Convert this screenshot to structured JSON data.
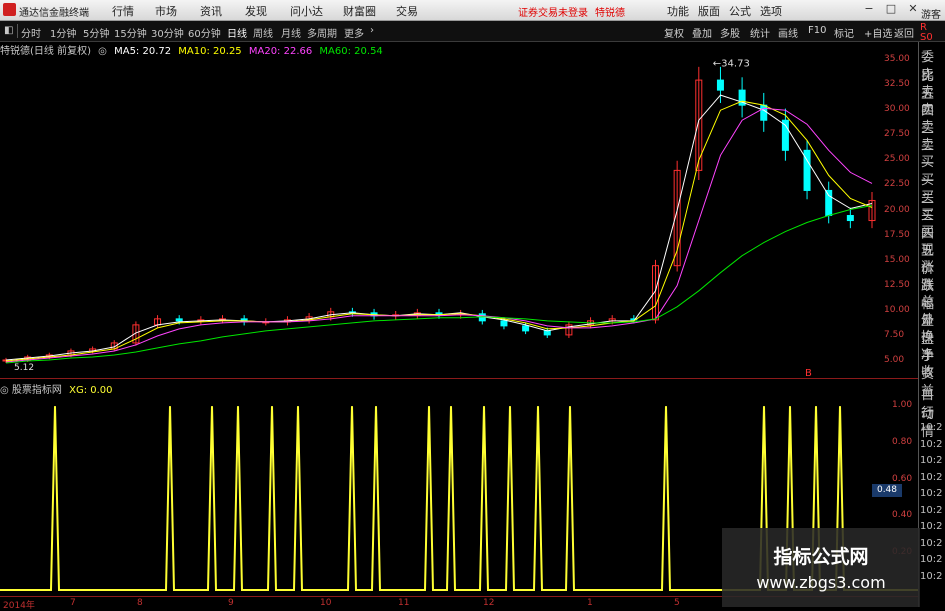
{
  "app": {
    "title": "通达信金融终端",
    "notice": "证券交易未登录",
    "stock_link": "特锐德"
  },
  "menu": [
    "行情",
    "市场",
    "资讯",
    "发现",
    "问小达",
    "财富圈",
    "交易"
  ],
  "menu_right": [
    "功能",
    "版面",
    "公式",
    "选项"
  ],
  "window_buttons": [
    "−",
    "□",
    "✕"
  ],
  "toolbar": {
    "periods": [
      "分时",
      "1分钟",
      "5分钟",
      "15分钟",
      "30分钟",
      "60分钟",
      "日线",
      "周线",
      "月线",
      "多周期",
      "更多"
    ],
    "active": "日线",
    "right": [
      "复权",
      "叠加",
      "多股",
      "统计",
      "画线",
      "F10",
      "标记",
      "+自选",
      "返回"
    ],
    "top_right": "游客"
  },
  "info": {
    "name": "特锐德(日线 前复权)",
    "ma5": "MA5: 20.72",
    "ma10": "MA10: 20.25",
    "ma20": "MA20: 22.66",
    "ma60": "MA60: 20.54"
  },
  "colors": {
    "ma5": "#ffffff",
    "ma10": "#ffff00",
    "ma20": "#ff44ff",
    "ma60": "#00e600",
    "up": "#ff3030",
    "down": "#00ffff",
    "signal": "#ffff33",
    "axis": "#d04040"
  },
  "price_axis": [
    "35.00",
    "32.50",
    "30.00",
    "27.50",
    "25.00",
    "22.50",
    "20.00",
    "17.50",
    "15.00",
    "12.50",
    "10.00",
    "7.50",
    "5.00"
  ],
  "annotations": {
    "high": "34.73",
    "low": "5.12",
    "marker": "B"
  },
  "indicator": {
    "name": "股票指标网",
    "value": "XG: 0.00",
    "axis": [
      "1.00",
      "0.80",
      "0.60",
      "0.40",
      "0.20"
    ],
    "current": "0.48"
  },
  "time_axis": [
    "2014年",
    "7",
    "8",
    "9",
    "10",
    "11",
    "12",
    "1",
    "5"
  ],
  "side_panel": {
    "main": [
      "委比",
      "卖五",
      "卖四",
      "卖三",
      "卖二",
      "卖一",
      "买一",
      "买二",
      "买三",
      "买四",
      "买五",
      "现价",
      "涨跌",
      "涨幅",
      "总量",
      "外盘",
      "换手",
      "净资",
      "收益"
    ],
    "lower": [
      "自动",
      "行情"
    ],
    "times": [
      "10:2",
      "10:2",
      "10:2",
      "10:2",
      "10:2",
      "10:2",
      "10:2",
      "10:2",
      "10:2",
      "10:2"
    ],
    "top_labels": [
      "R",
      "S0"
    ]
  },
  "watermark": {
    "line1": "指标公式网",
    "line2": "www.zbgs3.com"
  },
  "chart_data": {
    "type": "candlestick",
    "ylim": [
      4.5,
      36
    ],
    "grid": false,
    "series": [
      {
        "name": "MA5",
        "values": [
          5.1,
          5.3,
          5.5,
          5.8,
          6.0,
          6.4,
          7.8,
          8.6,
          8.9,
          9.0,
          9.1,
          9.0,
          8.9,
          9.0,
          9.2,
          9.6,
          9.8,
          9.6,
          9.5,
          9.7,
          9.6,
          9.8,
          9.4,
          9.1,
          8.6,
          8.0,
          8.4,
          8.7,
          9.0,
          9.0,
          12.0,
          20.0,
          29.0,
          31.5,
          30.8,
          30.0,
          28.5,
          25.0,
          21.5,
          20.2,
          20.7
        ]
      },
      {
        "name": "MA10",
        "values": [
          5.0,
          5.2,
          5.4,
          5.6,
          5.9,
          6.2,
          7.2,
          8.3,
          8.8,
          8.9,
          9.0,
          9.0,
          8.9,
          8.9,
          9.1,
          9.4,
          9.7,
          9.6,
          9.5,
          9.6,
          9.6,
          9.7,
          9.5,
          9.2,
          8.8,
          8.2,
          8.3,
          8.5,
          8.8,
          9.0,
          10.5,
          16.0,
          25.0,
          30.0,
          30.9,
          30.5,
          29.5,
          27.0,
          23.5,
          21.2,
          20.3
        ]
      },
      {
        "name": "MA20",
        "values": [
          4.9,
          5.1,
          5.3,
          5.5,
          5.7,
          6.0,
          6.6,
          7.5,
          8.2,
          8.6,
          8.8,
          8.9,
          8.9,
          8.9,
          9.0,
          9.2,
          9.5,
          9.5,
          9.5,
          9.5,
          9.5,
          9.6,
          9.5,
          9.3,
          9.0,
          8.5,
          8.3,
          8.3,
          8.5,
          8.8,
          9.2,
          12.5,
          19.0,
          25.5,
          29.0,
          30.2,
          30.0,
          28.6,
          26.0,
          23.8,
          22.7
        ]
      },
      {
        "name": "MA60",
        "values": [
          4.8,
          5.0,
          5.1,
          5.3,
          5.4,
          5.6,
          5.9,
          6.3,
          6.7,
          7.0,
          7.4,
          7.7,
          8.0,
          8.2,
          8.4,
          8.6,
          8.8,
          9.0,
          9.1,
          9.2,
          9.3,
          9.3,
          9.4,
          9.3,
          9.2,
          9.0,
          8.9,
          8.8,
          8.8,
          8.9,
          9.2,
          10.4,
          12.0,
          13.8,
          15.5,
          16.8,
          17.9,
          18.8,
          19.5,
          20.1,
          20.5
        ]
      }
    ],
    "candles_close": [
      5.1,
      5.4,
      5.6,
      6.0,
      6.2,
      6.8,
      8.6,
      9.2,
      9.0,
      9.1,
      9.2,
      8.9,
      8.9,
      9.1,
      9.4,
      9.9,
      9.8,
      9.5,
      9.6,
      9.8,
      9.6,
      9.7,
      9.0,
      8.5,
      8.0,
      7.6,
      8.6,
      9.0,
      9.2,
      9.1,
      14.5,
      24.0,
      33.0,
      32.0,
      30.5,
      29.0,
      26.0,
      22.0,
      19.5,
      19.0,
      21.0
    ],
    "signals_x": [
      55,
      170,
      212,
      238,
      272,
      298,
      352,
      376,
      429,
      451,
      484,
      510,
      538,
      570,
      666,
      764,
      790,
      816,
      840
    ],
    "indicator_ylim": [
      0,
      1.05
    ]
  }
}
